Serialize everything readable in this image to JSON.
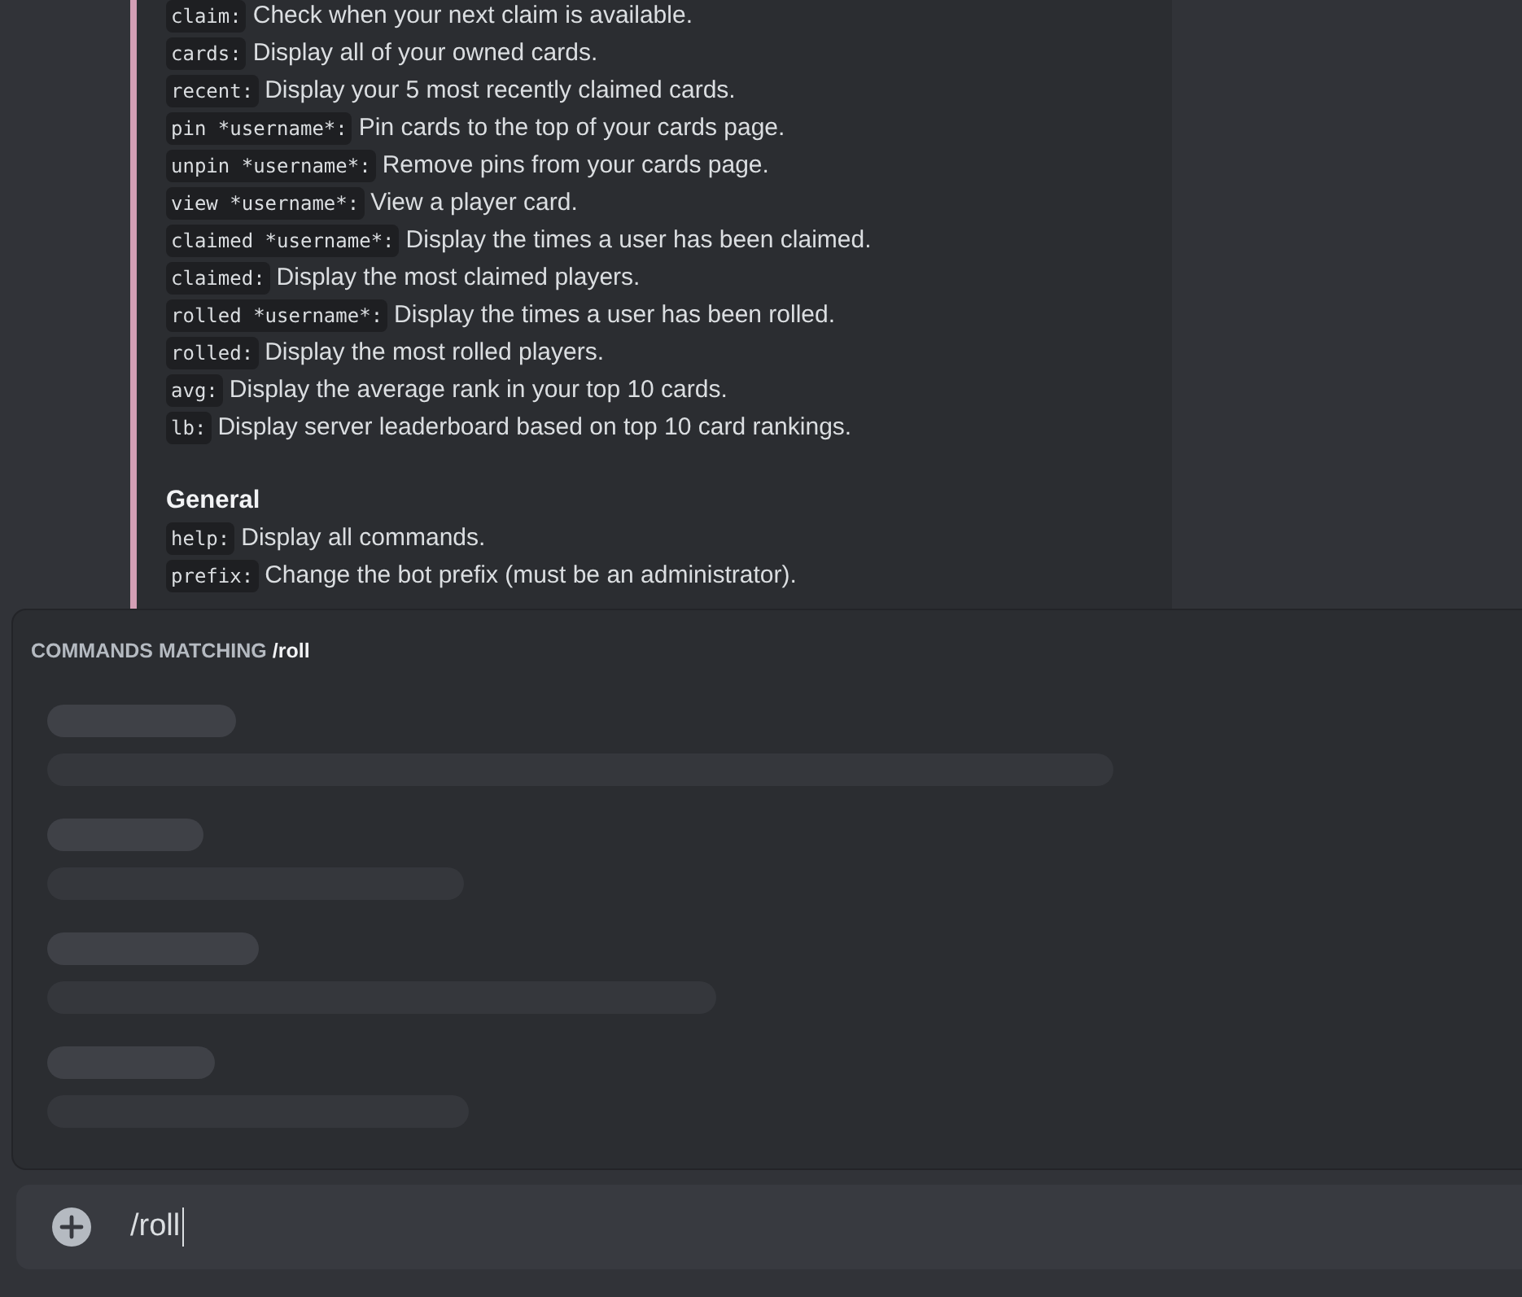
{
  "embed": {
    "sections": [
      {
        "commands": [
          {
            "code": "claim:",
            "description": "Check when your next claim is available."
          },
          {
            "code": "cards:",
            "description": "Display all of your owned cards."
          },
          {
            "code": "recent:",
            "description": "Display your 5 most recently claimed cards."
          },
          {
            "code": "pin *username*:",
            "description": "Pin cards to the top of your cards page."
          },
          {
            "code": "unpin *username*:",
            "description": "Remove pins from your cards page."
          },
          {
            "code": "view *username*:",
            "description": "View a player card."
          },
          {
            "code": "claimed *username*:",
            "description": "Display the times a user has been claimed."
          },
          {
            "code": "claimed:",
            "description": "Display the most claimed players."
          },
          {
            "code": "rolled *username*:",
            "description": "Display the times a user has been rolled."
          },
          {
            "code": "rolled:",
            "description": "Display the most rolled players."
          },
          {
            "code": "avg:",
            "description": "Display the average rank in your top 10 cards."
          },
          {
            "code": "lb:",
            "description": "Display server leaderboard based on top 10 card rankings."
          }
        ]
      },
      {
        "title": "General",
        "commands": [
          {
            "code": "help:",
            "description": "Display all commands."
          },
          {
            "code": "prefix:",
            "description": "Change the bot prefix (must be an administrator)."
          }
        ]
      }
    ]
  },
  "autocomplete": {
    "header": "COMMANDS MATCHING **/roll**"
  },
  "composer": {
    "value": "/roll"
  }
}
